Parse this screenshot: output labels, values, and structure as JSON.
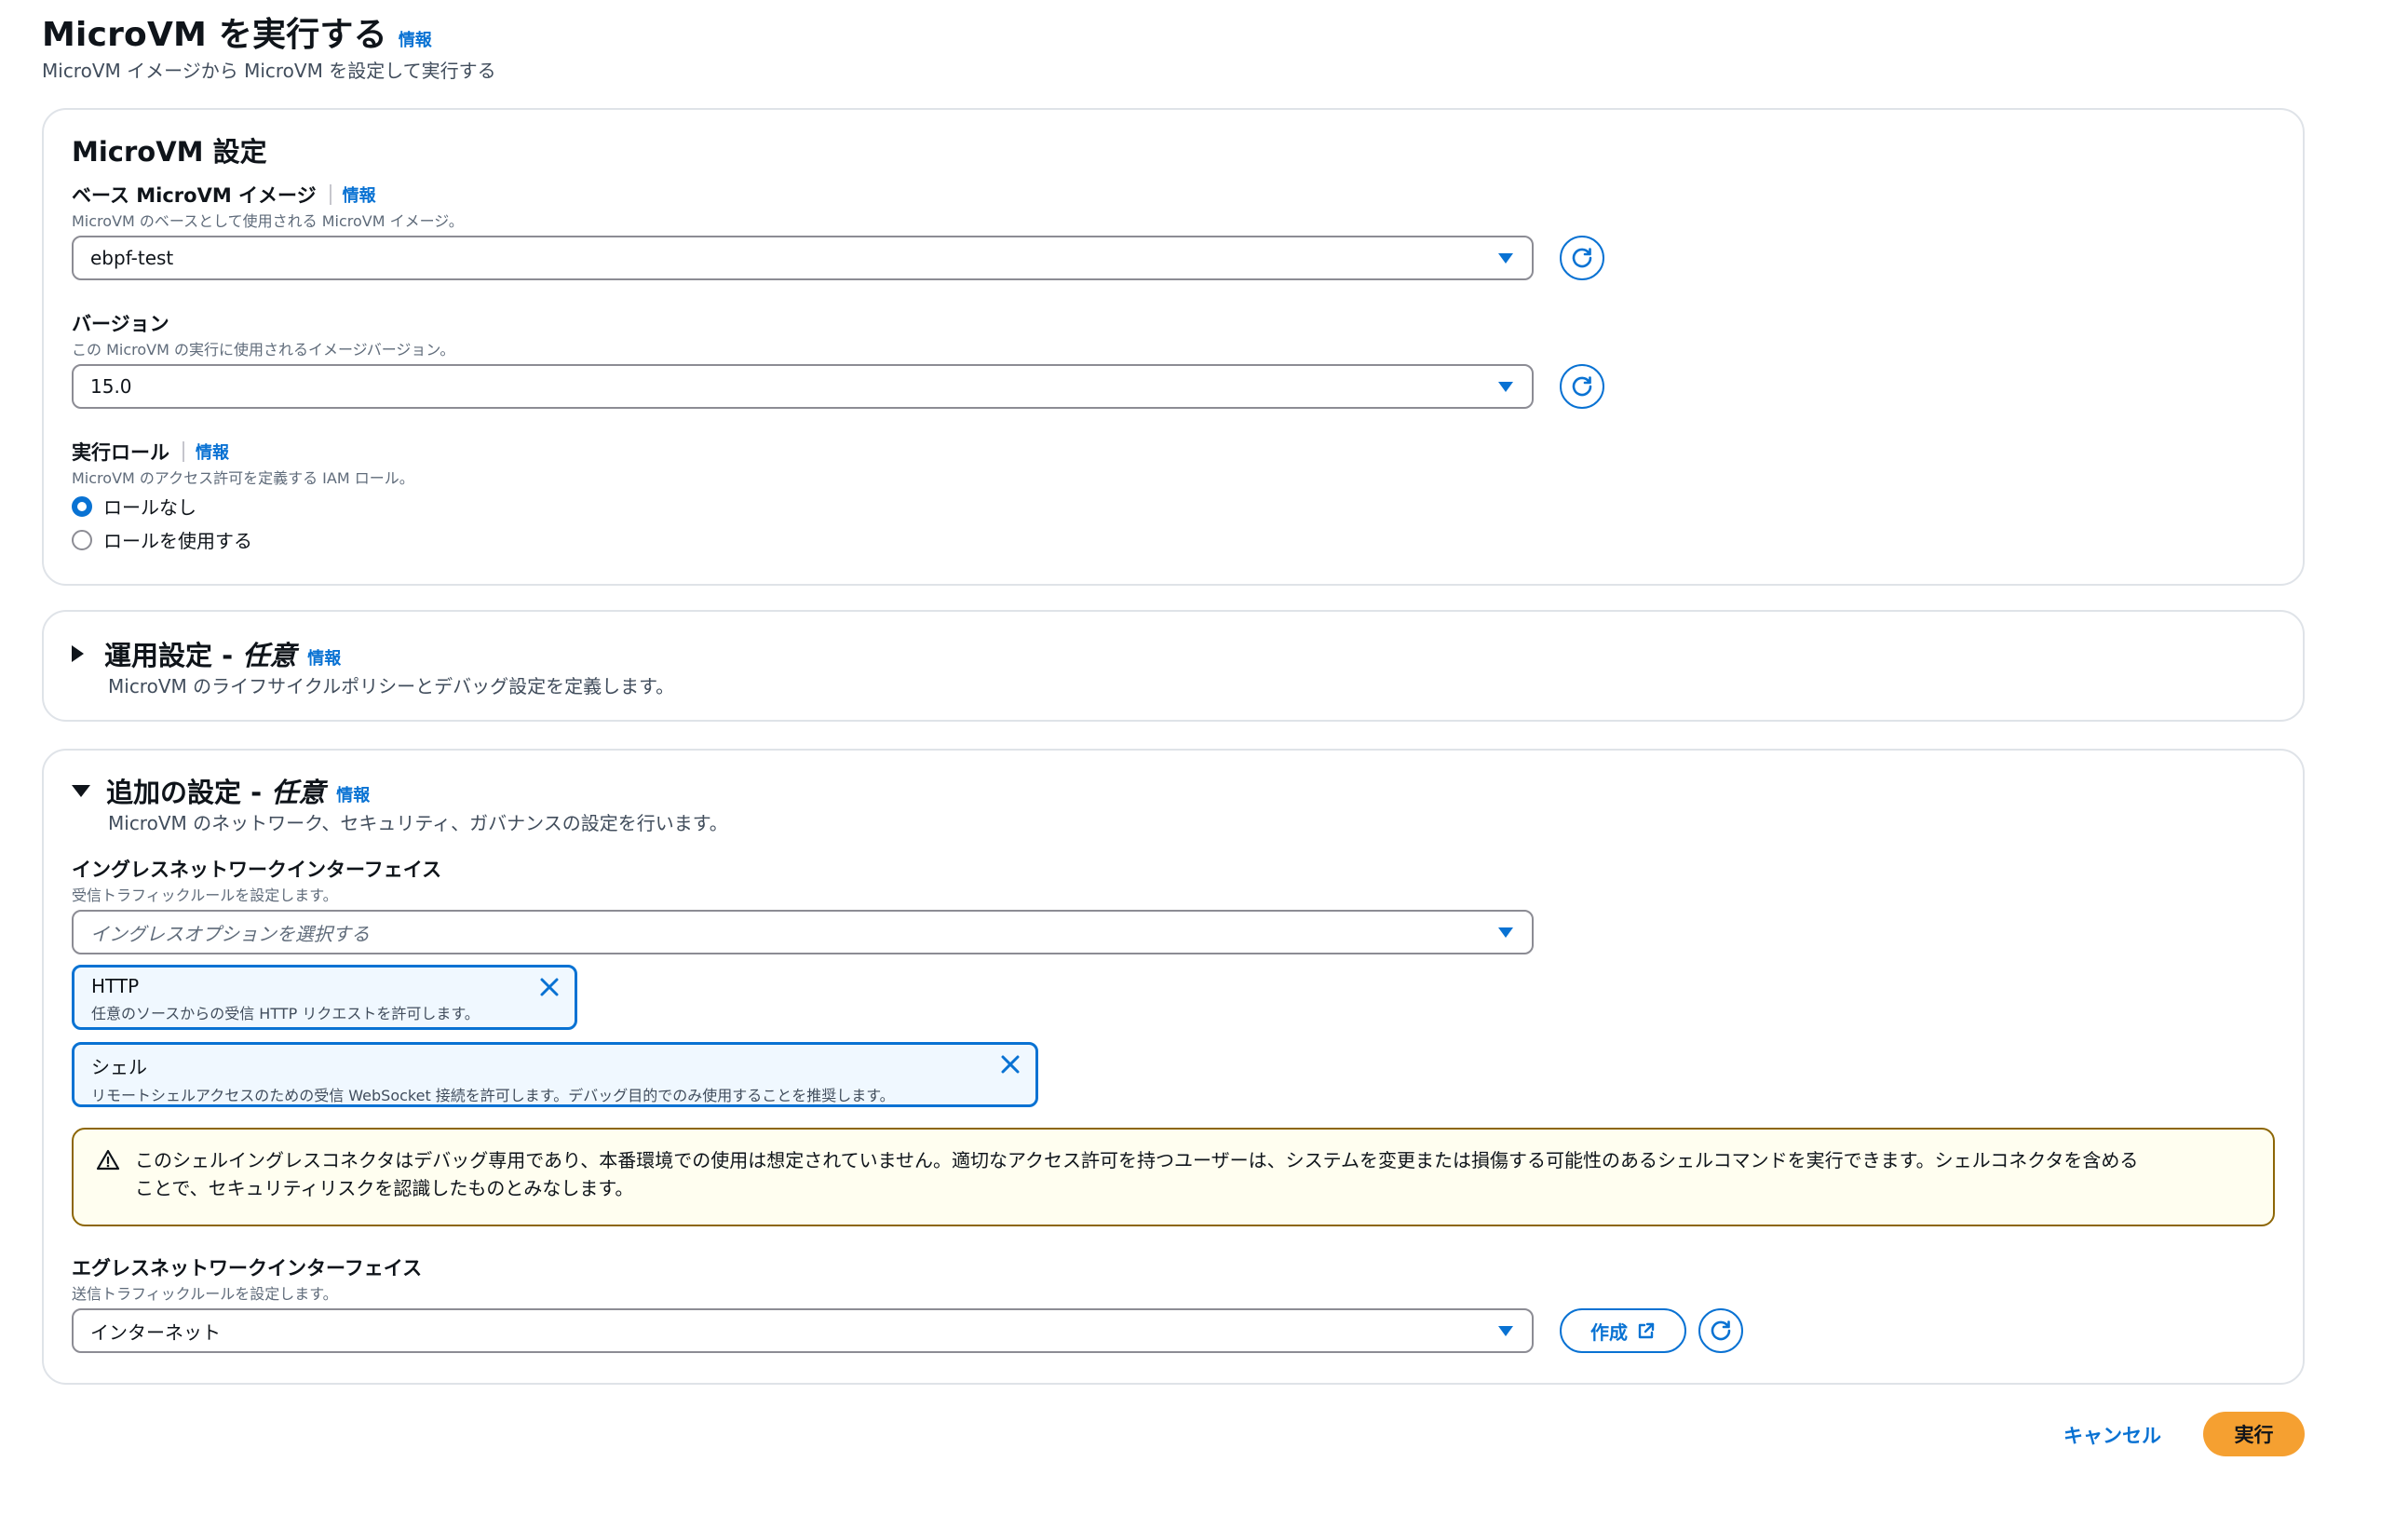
{
  "page": {
    "title": "MicroVM を実行する",
    "info": "情報",
    "subtitle": "MicroVM イメージから MicroVM を設定して実行する"
  },
  "microvm_settings": {
    "heading": "MicroVM 設定",
    "base_image": {
      "label": "ベース MicroVM イメージ",
      "info": "情報",
      "description": "MicroVM のベースとして使用される MicroVM イメージ。",
      "value": "ebpf-test"
    },
    "version": {
      "label": "バージョン",
      "description": "この MicroVM の実行に使用されるイメージバージョン。",
      "value": "15.0"
    },
    "execution_role": {
      "label": "実行ロール",
      "info": "情報",
      "description": "MicroVM のアクセス許可を定義する IAM ロール。",
      "options": [
        {
          "label": "ロールなし",
          "selected": true
        },
        {
          "label": "ロールを使用する",
          "selected": false
        }
      ]
    }
  },
  "operational_settings": {
    "title": "運用設定 - ",
    "optional": "任意",
    "info": "情報",
    "description": "MicroVM のライフサイクルポリシーとデバッグ設定を定義します。",
    "expanded": false
  },
  "additional_settings": {
    "title": "追加の設定 - ",
    "optional": "任意",
    "info": "情報",
    "description": "MicroVM のネットワーク、セキュリティ、ガバナンスの設定を行います。",
    "expanded": true,
    "ingress": {
      "label": "イングレスネットワークインターフェイス",
      "description": "受信トラフィックルールを設定します。",
      "placeholder": "イングレスオプションを選択する",
      "tokens": [
        {
          "label": "HTTP",
          "description": "任意のソースからの受信 HTTP リクエストを許可します。"
        },
        {
          "label": "シェル",
          "description": "リモートシェルアクセスのための受信 WebSocket 接続を許可します。デバッグ目的でのみ使用することを推奨します。"
        }
      ]
    },
    "warning": {
      "line1": "このシェルイングレスコネクタはデバッグ専用であり、本番環境での使用は想定されていません。適切なアクセス許可を持つユーザーは、システムを変更または損傷する可能性のあるシェルコマンドを実行できます。シェルコネクタを含める",
      "line2": "ことで、セキュリティリスクを認識したものとみなします。"
    },
    "egress": {
      "label": "エグレスネットワークインターフェイス",
      "description": "送信トラフィックルールを設定します。",
      "value": "インターネット",
      "create_label": "作成"
    }
  },
  "footer": {
    "cancel_label": "キャンセル",
    "run_label": "実行"
  },
  "colors": {
    "accent": "#0972d3",
    "primary_button": "#f5a031",
    "warning_border": "#8d6605"
  }
}
